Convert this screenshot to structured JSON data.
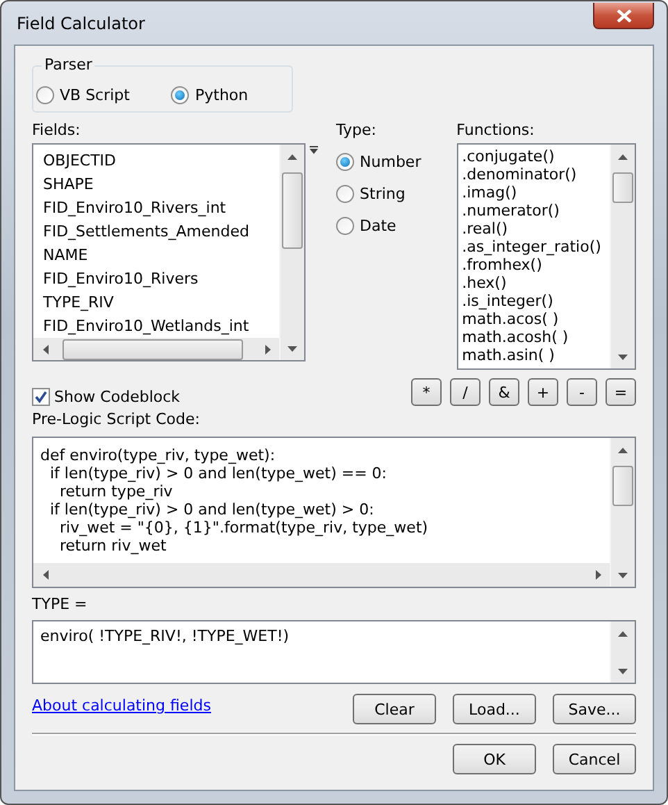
{
  "window": {
    "title": "Field Calculator"
  },
  "parser": {
    "label": "Parser",
    "options": [
      {
        "label": "VB Script",
        "selected": false
      },
      {
        "label": "Python",
        "selected": true
      }
    ]
  },
  "fields": {
    "label": "Fields:",
    "items": [
      "OBJECTID",
      "SHAPE",
      "FID_Enviro10_Rivers_int",
      "FID_Settlements_Amended",
      "NAME",
      "FID_Enviro10_Rivers",
      "TYPE_RIV",
      "FID_Enviro10_Wetlands_int"
    ]
  },
  "type": {
    "label": "Type:",
    "options": [
      {
        "label": "Number",
        "selected": true
      },
      {
        "label": "String",
        "selected": false
      },
      {
        "label": "Date",
        "selected": false
      }
    ]
  },
  "functions": {
    "label": "Functions:",
    "items": [
      ".conjugate()",
      ".denominator()",
      ".imag()",
      ".numerator()",
      ".real()",
      ".as_integer_ratio()",
      ".fromhex()",
      ".hex()",
      ".is_integer()",
      "math.acos( )",
      "math.acosh( )",
      "math.asin( )"
    ]
  },
  "show_codeblock": {
    "label": "Show Codeblock",
    "checked": true
  },
  "operators": [
    "*",
    "/",
    "&",
    "+",
    "-",
    "="
  ],
  "pre_logic": {
    "label": "Pre-Logic Script Code:",
    "lines": [
      "def enviro(type_riv, type_wet):",
      "  if len(type_riv) > 0 and len(type_wet) == 0:",
      "    return type_riv",
      "  if len(type_riv) > 0 and len(type_wet) > 0:",
      "    riv_wet = \"{0}, {1}\".format(type_riv, type_wet)",
      "    return riv_wet"
    ]
  },
  "expression": {
    "label": "TYPE =",
    "value": "enviro( !TYPE_RIV!, !TYPE_WET!)"
  },
  "link": "About calculating fields",
  "file_buttons": [
    "Clear",
    "Load...",
    "Save..."
  ],
  "dialog_buttons": [
    "OK",
    "Cancel"
  ]
}
